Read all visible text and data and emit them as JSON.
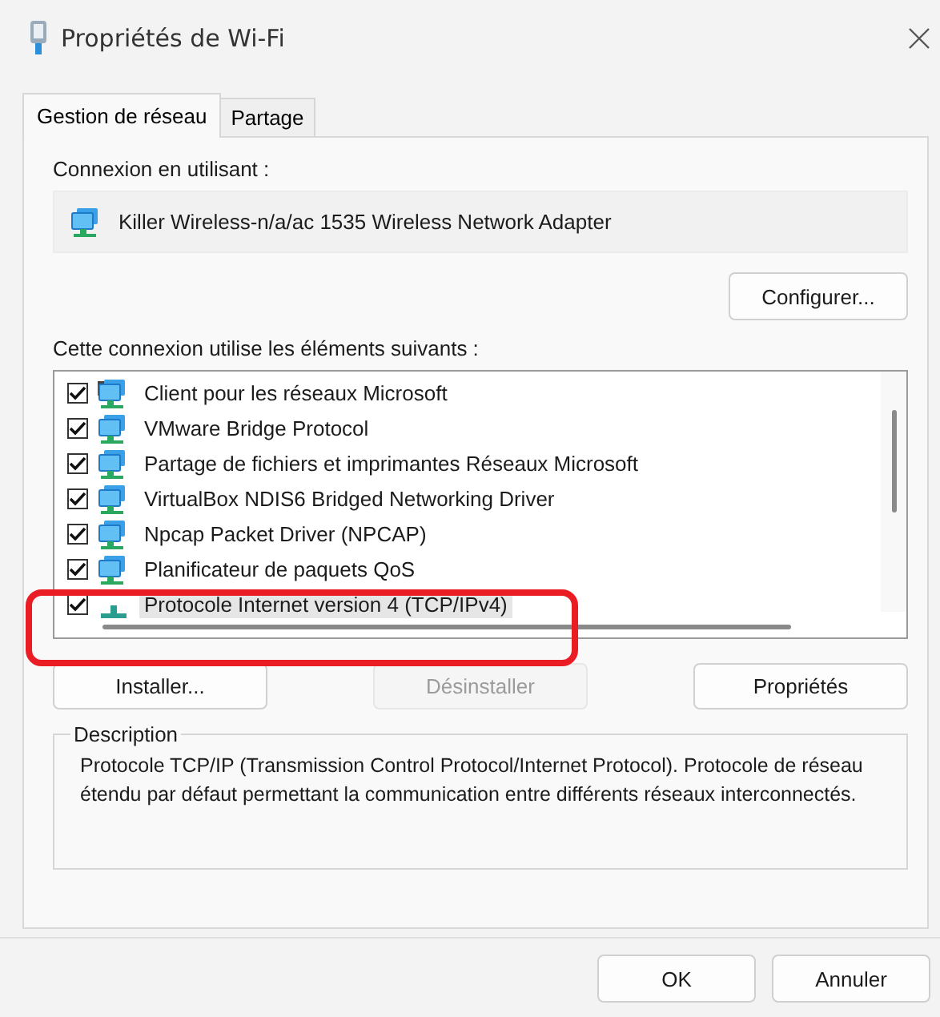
{
  "window": {
    "title": "Propriétés de Wi-Fi"
  },
  "tabs": [
    {
      "label": "Gestion de réseau",
      "selected": true
    },
    {
      "label": "Partage",
      "selected": false
    }
  ],
  "connection_label": "Connexion en utilisant :",
  "adapter": "Killer Wireless-n/a/ac 1535 Wireless Network Adapter",
  "configure_button": "Configurer...",
  "items_label": "Cette connexion utilise les éléments suivants :",
  "items": [
    {
      "label": "Client pour les réseaux Microsoft",
      "checked": true,
      "selected": false,
      "kind": "client"
    },
    {
      "label": "VMware Bridge Protocol",
      "checked": true,
      "selected": false,
      "kind": "service"
    },
    {
      "label": "Partage de fichiers et imprimantes Réseaux Microsoft",
      "checked": true,
      "selected": false,
      "kind": "service"
    },
    {
      "label": "VirtualBox NDIS6 Bridged Networking Driver",
      "checked": true,
      "selected": false,
      "kind": "service"
    },
    {
      "label": "Npcap Packet Driver (NPCAP)",
      "checked": true,
      "selected": false,
      "kind": "service"
    },
    {
      "label": "Planificateur de paquets QoS",
      "checked": true,
      "selected": false,
      "kind": "service"
    },
    {
      "label": "Protocole Internet version 4 (TCP/IPv4)",
      "checked": true,
      "selected": true,
      "kind": "protocol"
    }
  ],
  "item_buttons": [
    {
      "label": "Installer...",
      "disabled": false
    },
    {
      "label": "Désinstaller",
      "disabled": true
    },
    {
      "label": "Propriétés",
      "disabled": false
    }
  ],
  "description": {
    "title": "Description",
    "text": "Protocole TCP/IP (Transmission Control Protocol/Internet Protocol). Protocole de réseau étendu par défaut permettant la communication entre différents réseaux interconnectés."
  },
  "buttons": [
    "OK",
    "Annuler"
  ]
}
